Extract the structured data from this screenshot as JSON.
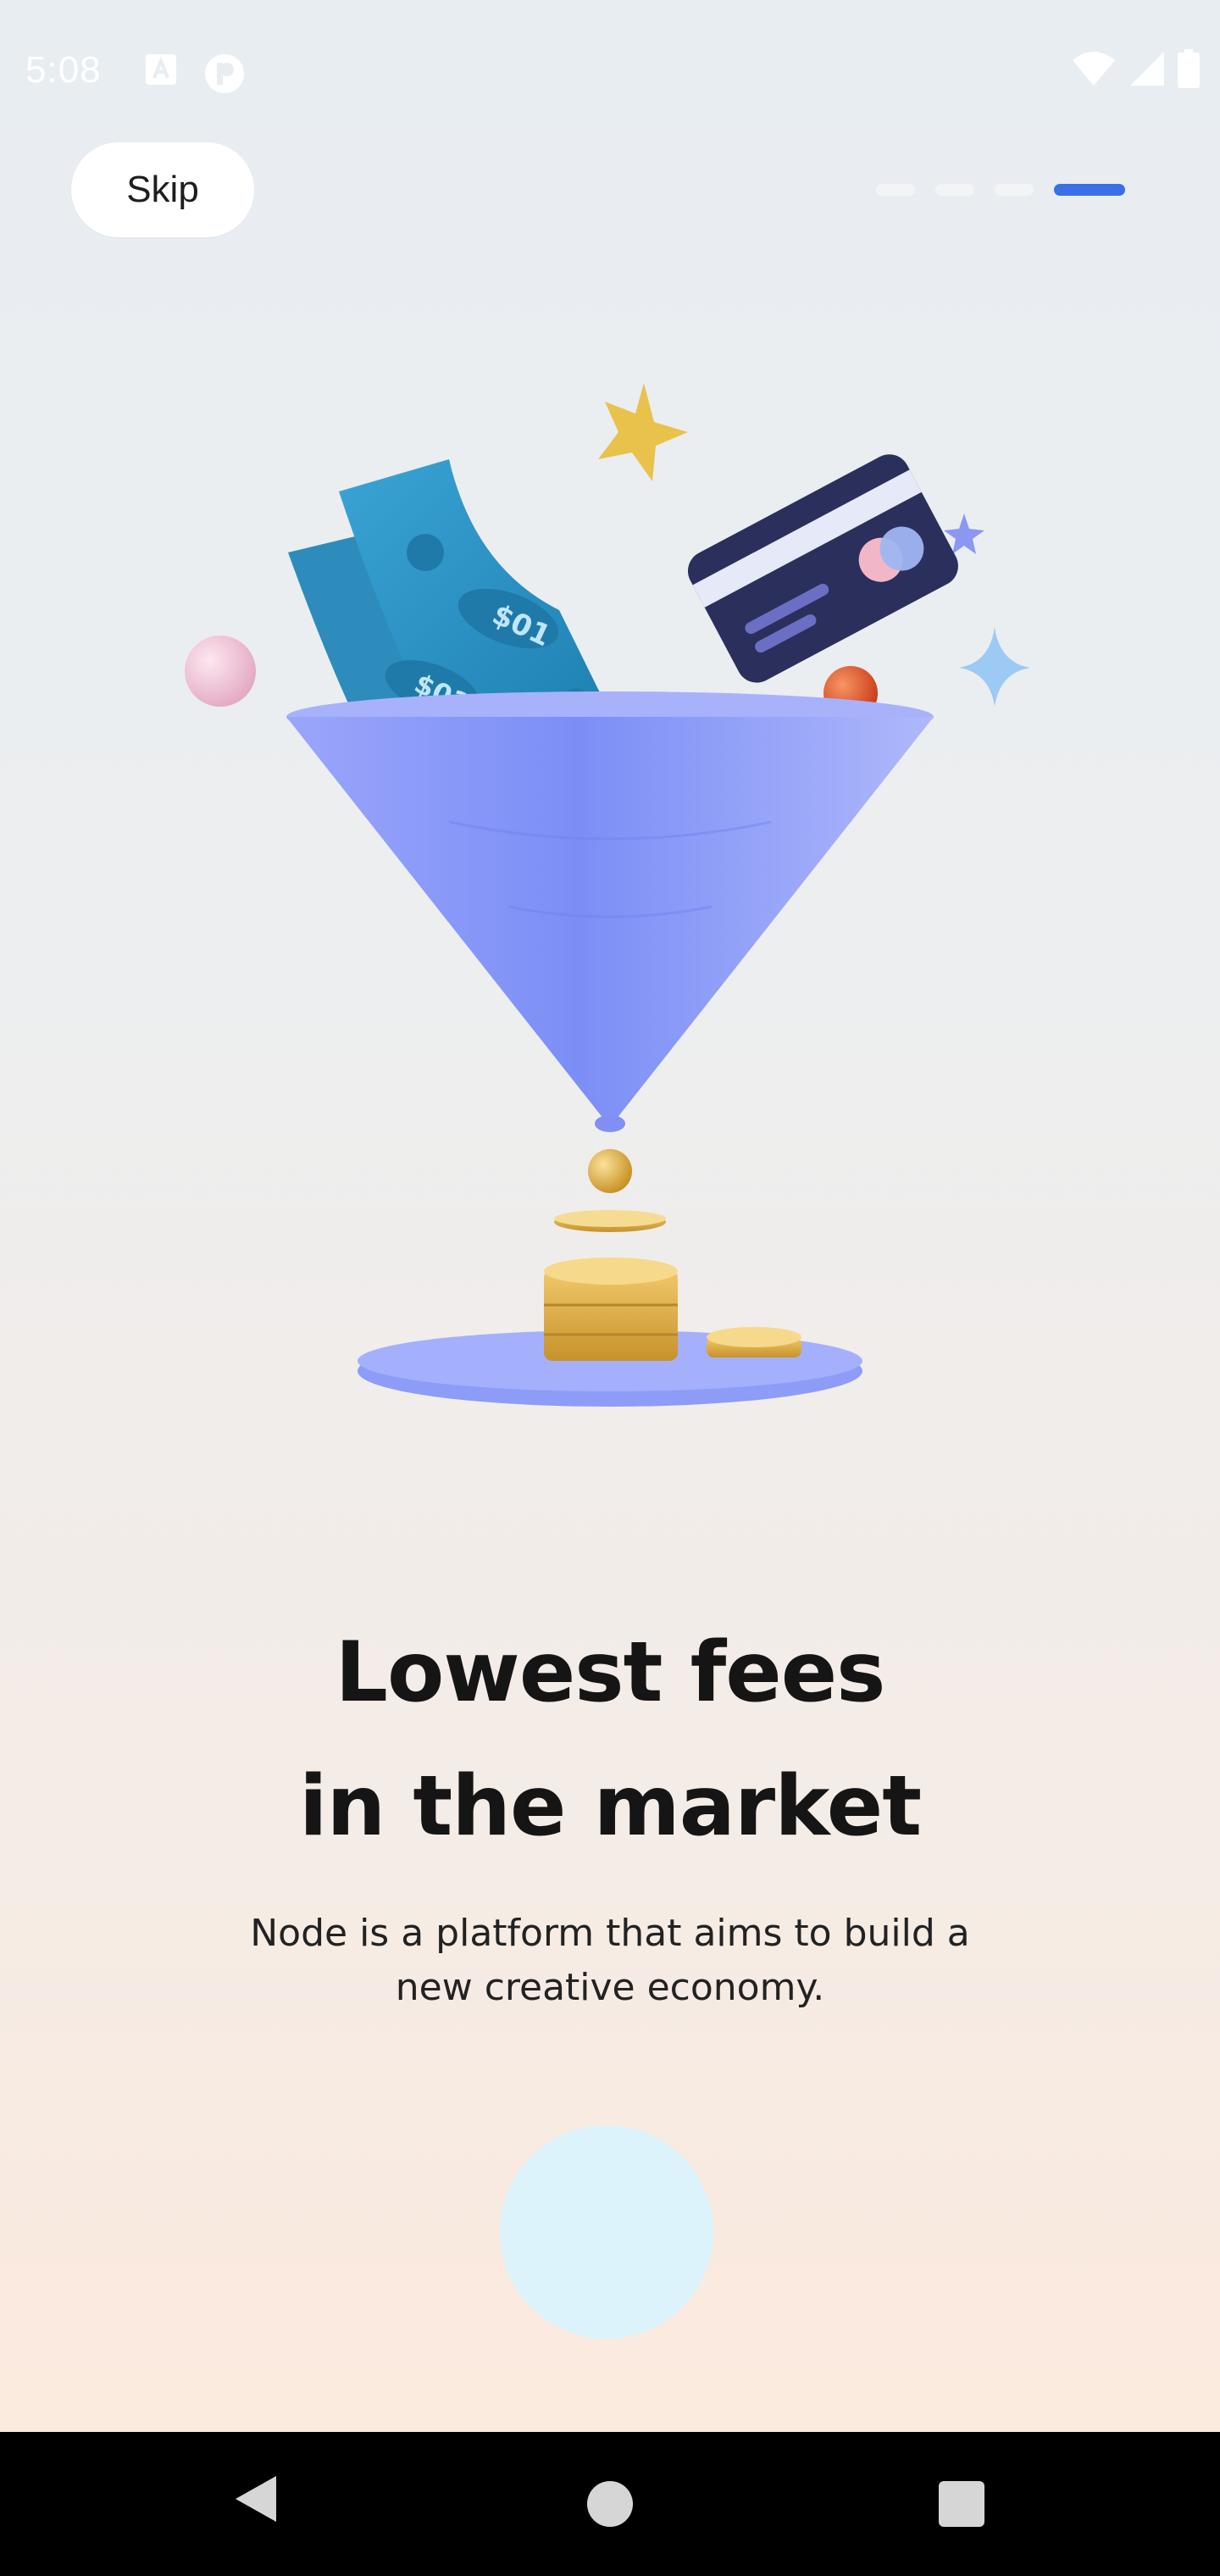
{
  "status_bar": {
    "time": "5:08",
    "left_icons": [
      "a-app-icon",
      "p-app-icon"
    ],
    "right_icons": [
      "wifi-icon",
      "signal-icon",
      "battery-icon"
    ]
  },
  "top": {
    "skip_label": "Skip",
    "page_indicator": {
      "total": 4,
      "active_index": 3,
      "active_color": "#3a6fe8"
    }
  },
  "illustration": {
    "subject": "funnel-with-money-icon"
  },
  "content": {
    "headline_line1": "Lowest fees",
    "headline_line2": "in the market",
    "subtitle_line1": "Node is a platform that aims to build a",
    "subtitle_line2": "new creative economy."
  },
  "next_button": {
    "color": "#ddf3fb"
  },
  "nav": {
    "icons": [
      "back-icon",
      "home-icon",
      "recents-icon"
    ]
  }
}
